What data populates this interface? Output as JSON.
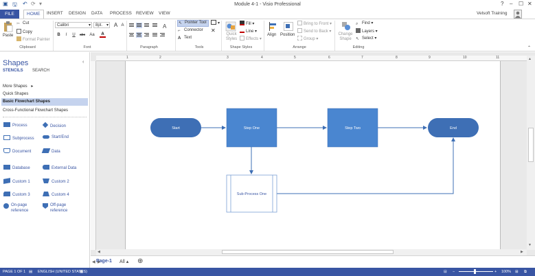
{
  "window": {
    "title": "Module 4-1 - Visio Professional",
    "user": "Velsoft Training",
    "help": "?",
    "min": "–",
    "max": "☐",
    "close": "✕"
  },
  "tabs": [
    "FILE",
    "HOME",
    "INSERT",
    "DESIGN",
    "DATA",
    "PROCESS",
    "REVIEW",
    "VIEW"
  ],
  "ribbon": {
    "clipboard": {
      "paste": "Paste",
      "cut": "Cut",
      "copy": "Copy",
      "format_painter": "Format Painter",
      "label": "Clipboard"
    },
    "font": {
      "family": "Calibri",
      "size": "8pt.",
      "bold": "B",
      "italic": "I",
      "underline": "U",
      "strike": "abc",
      "case": "Aa",
      "grow": "A",
      "shrink": "A",
      "color": "A",
      "label": "Font"
    },
    "paragraph": {
      "label": "Paragraph"
    },
    "tools": {
      "pointer": "Pointer Tool",
      "connector": "Connector",
      "text": "Text",
      "label": "Tools"
    },
    "shape_styles": {
      "quick_styles": "Quick Styles",
      "fill": "Fill",
      "line": "Line",
      "effects": "Effects",
      "label": "Shape Styles"
    },
    "arrange": {
      "align": "Align",
      "position": "Position",
      "bring_front": "Bring to Front",
      "send_back": "Send to Back",
      "group": "Group",
      "label": "Arrange"
    },
    "editing": {
      "change_shape": "Change Shape",
      "find": "Find",
      "layers": "Layers",
      "select": "Select",
      "label": "Editing"
    }
  },
  "shapes_pane": {
    "title": "Shapes",
    "tab_stencils": "STENCILS",
    "tab_search": "SEARCH",
    "collapse": "‹",
    "stencils": [
      "More Shapes",
      "Quick Shapes",
      "Basic Flowchart Shapes",
      "Cross-Functional Flowchart Shapes"
    ],
    "more_arrow": "▸",
    "items": [
      [
        "Process",
        "Decision"
      ],
      [
        "Subprocess",
        "Start/End"
      ],
      [
        "Document",
        "Data"
      ],
      [
        "Database",
        "External Data"
      ],
      [
        "Custom 1",
        "Custom 2"
      ],
      [
        "Custom 3",
        "Custom 4"
      ],
      [
        "On-page reference",
        "Off-page reference"
      ]
    ]
  },
  "ruler": [
    "1",
    "2",
    "3",
    "4",
    "5",
    "6",
    "7",
    "8",
    "9",
    "10",
    "11"
  ],
  "diagram": {
    "start": "Start",
    "step1": "Step One",
    "step2": "Step Two",
    "end": "End",
    "sub": "Sub-Process One"
  },
  "pagebar": {
    "page": "Page-1",
    "all": "All ▴",
    "add": "⊕"
  },
  "status": {
    "page": "PAGE 1 OF 1",
    "lang": "ENGLISH (UNITED STATES)",
    "zoom": "100%"
  },
  "colors": {
    "accent": "#3955a3",
    "shape": "#3e6fb5",
    "shape_light": "#4a86d0"
  }
}
